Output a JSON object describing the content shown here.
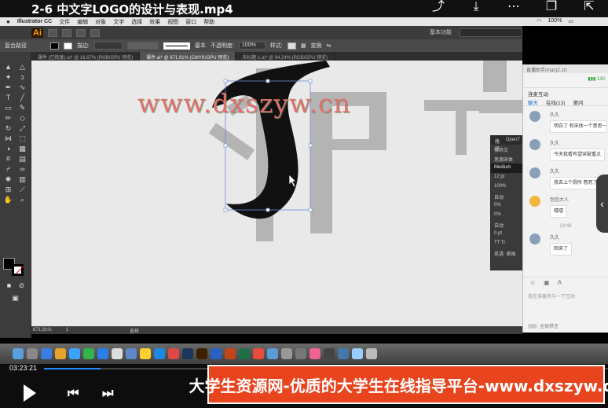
{
  "video": {
    "title": "2-6 中文字LOGO的设计与表现.mp4",
    "top_icons": [
      "share-icon",
      "download-icon",
      "more-icon",
      "pip-icon",
      "exit-icon"
    ],
    "current_time": "03:23:21",
    "progress": 0.1,
    "banner": "大学生资源网-优质的大学生在线指导平台-www.dxszyw.cn"
  },
  "menubar": {
    "apple": "",
    "app": "Illustrator CC",
    "items": [
      "文件",
      "编辑",
      "对象",
      "文字",
      "选择",
      "效果",
      "视图",
      "窗口",
      "帮助"
    ],
    "battery": "100%"
  },
  "appbar": {
    "logo": "Ai",
    "workspace": "基本功能"
  },
  "control": {
    "label": "复合路径",
    "stroke_label": "描边:",
    "stroke_style": "基本",
    "opacity_label": "不透明度:",
    "opacity_value": "100%",
    "style_label": "样式:",
    "transform_label": "变换"
  },
  "tabs": [
    {
      "label": "课件 (已恢复).ai* @ 16.67% (RGB/GPU 预览)",
      "active": false
    },
    {
      "label": "课件.ai* @ 671.91% (CMYK/GPU 预览)",
      "active": true
    },
    {
      "label": "未标题-1.ai* @ 94.24% (RGB/GPU 预览)",
      "active": false
    }
  ],
  "canvas": {
    "watermark": "www.dxszyw.cn",
    "zoom": "671.91%",
    "page": "1",
    "status": "选择"
  },
  "char_panel": {
    "tabs": [
      "路径",
      "OpenT"
    ],
    "rows": [
      "修饰文",
      "思源宋体",
      "Medium",
      "12 pt",
      "100%",
      "自动",
      "0%",
      "0%",
      "自动",
      "0 pt",
      "TT Tr",
      "英语: 美国"
    ]
  },
  "chat": {
    "title": "直播助手(mac)2.10.",
    "signal": "130",
    "header": "连麦互动",
    "tabs": [
      "聊天",
      "在线(13)",
      "要问"
    ],
    "messages": [
      {
        "user": "久久",
        "text": "明白了 和宋体一个意思一样 笔画不一样"
      },
      {
        "user": "久久",
        "text": "今天我看有望突破重点"
      },
      {
        "user": "久久",
        "text": "我去上个厕所 憋死了"
      },
      {
        "user": "包包大人",
        "text": "嘻嘻"
      }
    ],
    "time": "23:49",
    "last": {
      "user": "久久",
      "text": "回来了"
    },
    "input_placeholder": "我在准备参与一下互动",
    "mute_label": "全体禁言"
  },
  "colors": {
    "accent": "#1f8cff",
    "banner": "#e8441e",
    "watermark": "#e07070"
  }
}
